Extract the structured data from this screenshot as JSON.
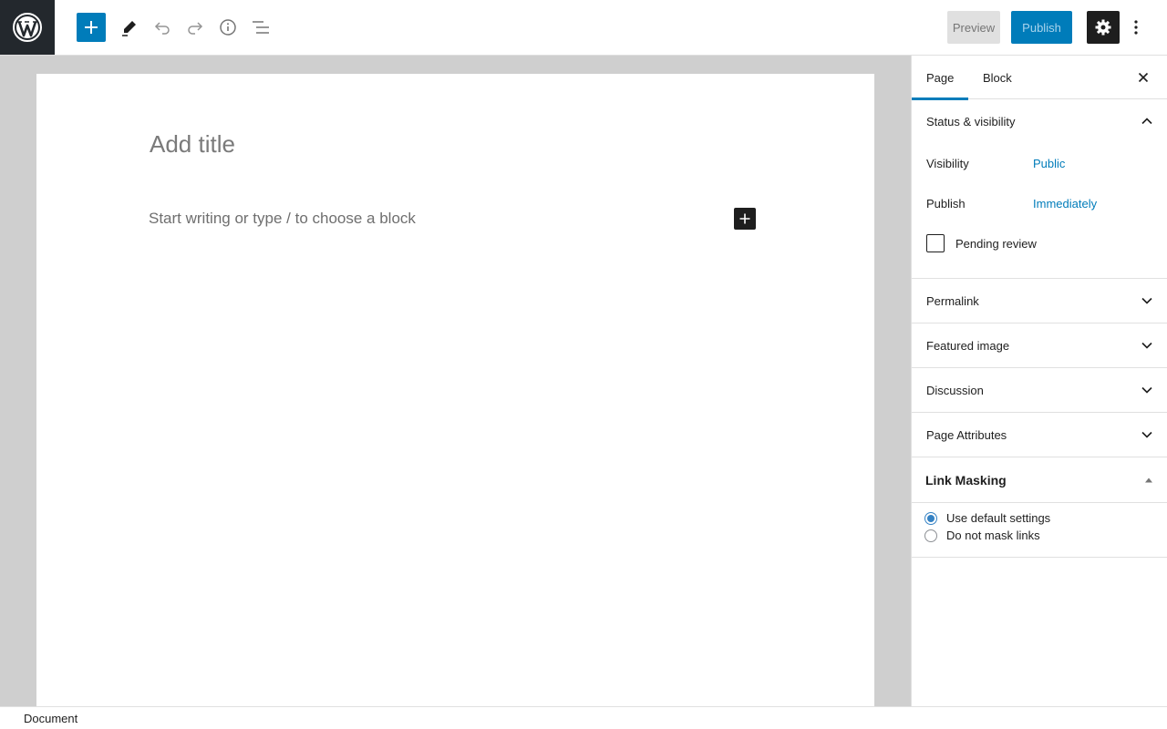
{
  "toolbar": {
    "preview_label": "Preview",
    "publish_label": "Publish",
    "icons": [
      "wordpress-logo-icon",
      "plus-icon",
      "pencil-icon",
      "undo-icon",
      "redo-icon",
      "info-icon",
      "list-view-icon",
      "gear-icon",
      "more-vertical-icon"
    ]
  },
  "editor": {
    "title_placeholder": "Add title",
    "paragraph_placeholder": "Start writing or type / to choose a block"
  },
  "sidebar": {
    "tabs": [
      {
        "label": "Page",
        "active": true
      },
      {
        "label": "Block",
        "active": false
      }
    ],
    "status_visibility": {
      "title": "Status & visibility",
      "visibility_label": "Visibility",
      "visibility_value": "Public",
      "publish_label": "Publish",
      "publish_value": "Immediately",
      "pending_review_label": "Pending review",
      "pending_review_checked": false
    },
    "panels": [
      {
        "label": "Permalink"
      },
      {
        "label": "Featured image"
      },
      {
        "label": "Discussion"
      },
      {
        "label": "Page Attributes"
      }
    ],
    "link_masking": {
      "title": "Link Masking",
      "options": [
        {
          "label": "Use default settings",
          "selected": true
        },
        {
          "label": "Do not mask links",
          "selected": false
        }
      ]
    }
  },
  "footer": {
    "breadcrumb": "Document"
  },
  "colors": {
    "accent": "#007cba",
    "dark": "#1e1e1e",
    "canvas_bg": "#cfcfcf"
  }
}
